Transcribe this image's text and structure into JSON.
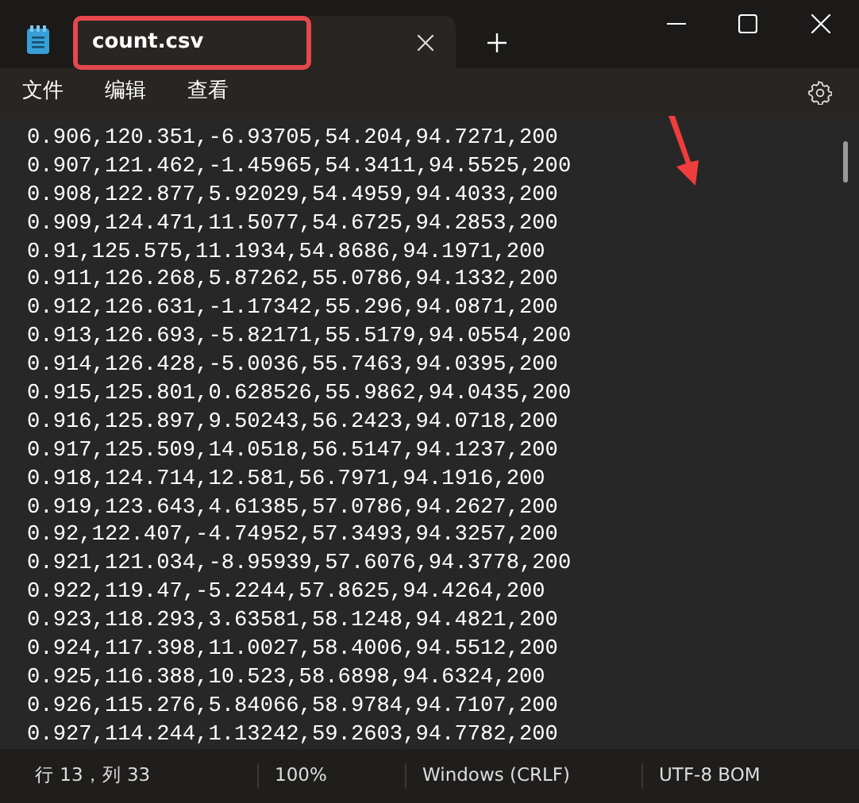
{
  "tabs": [
    {
      "title": "count.csv",
      "selected": true
    }
  ],
  "menu": [
    "文件",
    "编辑",
    "查看"
  ],
  "lines": [
    "0.906,120.351,-6.93705,54.204,94.7271,200",
    "0.907,121.462,-1.45965,54.3411,94.5525,200",
    "0.908,122.877,5.92029,54.4959,94.4033,200",
    "0.909,124.471,11.5077,54.6725,94.2853,200",
    "0.91,125.575,11.1934,54.8686,94.1971,200",
    "0.911,126.268,5.87262,55.0786,94.1332,200",
    "0.912,126.631,-1.17342,55.296,94.0871,200",
    "0.913,126.693,-5.82171,55.5179,94.0554,200",
    "0.914,126.428,-5.0036,55.7463,94.0395,200",
    "0.915,125.801,0.628526,55.9862,94.0435,200",
    "0.916,125.897,9.50243,56.2423,94.0718,200",
    "0.917,125.509,14.0518,56.5147,94.1237,200",
    "0.918,124.714,12.581,56.7971,94.1916,200",
    "0.919,123.643,4.61385,57.0786,94.2627,200",
    "0.92,122.407,-4.74952,57.3493,94.3257,200",
    "0.921,121.034,-8.95939,57.6076,94.3778,200",
    "0.922,119.47,-5.2244,57.8625,94.4264,200",
    "0.923,118.293,3.63581,58.1248,94.4821,200",
    "0.924,117.398,11.0027,58.4006,94.5512,200",
    "0.925,116.388,10.523,58.6898,94.6324,200",
    "0.926,115.276,5.84066,58.9784,94.7107,200",
    "0.927,114.244,1.13242,59.2603,94.7782,200"
  ],
  "status_bar": [
    "行 13，列 33",
    "100%",
    "Windows (CRLF)",
    "UTF-8 BOM"
  ]
}
